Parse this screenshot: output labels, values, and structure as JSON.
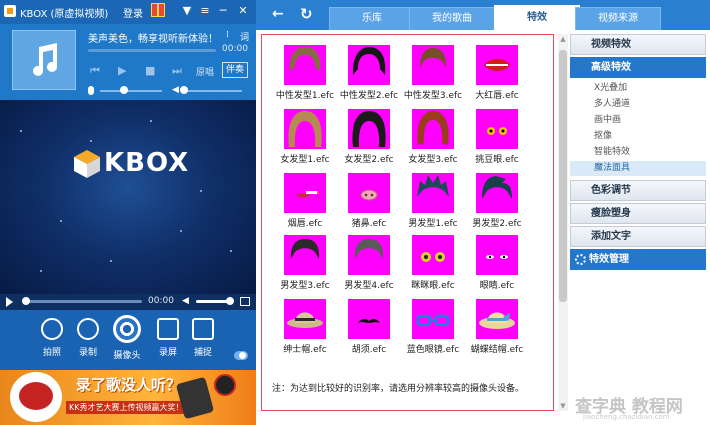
{
  "app": {
    "title": "KBOX (原虚拟视频)",
    "login_label": "登录"
  },
  "now_playing": {
    "song_title": "美声美色，畅享视听新体验！",
    "lyric_label": "词",
    "time": "00:00",
    "original_label": "原唱",
    "accompany_label": "伴奏",
    "progress": 0.0
  },
  "video": {
    "logo_text": "KBOX"
  },
  "playback": {
    "time": "00:00",
    "progress": 0.0,
    "volume": 0.8
  },
  "tools": [
    {
      "name": "photo",
      "label": "拍照",
      "icon": "camera-icon"
    },
    {
      "name": "record",
      "label": "录制",
      "icon": "video-record-icon"
    },
    {
      "name": "webcam",
      "label": "摄像头",
      "icon": "webcam-icon"
    },
    {
      "name": "screen-record",
      "label": "录屏",
      "icon": "screen-record-icon"
    },
    {
      "name": "capture",
      "label": "捕捉",
      "icon": "capture-icon"
    }
  ],
  "ad": {
    "headline": "录了歌没人听？",
    "subtext": "KK秀才艺大赛上传视频赢大奖！"
  },
  "tabs": [
    {
      "label": "乐库",
      "active": false
    },
    {
      "label": "我的歌曲",
      "active": false
    },
    {
      "label": "特效",
      "active": true
    },
    {
      "label": "视频来源",
      "active": false
    }
  ],
  "effects": [
    {
      "name": "中性发型1.efc",
      "kind": "hair-short-light"
    },
    {
      "name": "中性发型2.efc",
      "kind": "hair-black"
    },
    {
      "name": "中性发型3.efc",
      "kind": "hair-brown"
    },
    {
      "name": "大红唇.efc",
      "kind": "lips"
    },
    {
      "name": "女发型1.efc",
      "kind": "hair-long-light"
    },
    {
      "name": "女发型2.efc",
      "kind": "hair-long-black"
    },
    {
      "name": "女发型3.efc",
      "kind": "hair-red"
    },
    {
      "name": "挑豆眼.efc",
      "kind": "eyes-yellow"
    },
    {
      "name": "烟唇.efc",
      "kind": "cigarette"
    },
    {
      "name": "猪鼻.efc",
      "kind": "pig-nose"
    },
    {
      "name": "男发型1.efc",
      "kind": "hair-punk-teal"
    },
    {
      "name": "男发型2.efc",
      "kind": "hair-punk-teal2"
    },
    {
      "name": "男发型3.efc",
      "kind": "hair-man-dark"
    },
    {
      "name": "男发型4.efc",
      "kind": "hair-man-gray"
    },
    {
      "name": "眯眯眼.efc",
      "kind": "eyes-round"
    },
    {
      "name": "眼睛.efc",
      "kind": "eyes-small"
    },
    {
      "name": "绅士帽.efc",
      "kind": "hat-gentleman"
    },
    {
      "name": "胡须.efc",
      "kind": "mustache"
    },
    {
      "name": "蓝色眼镜.efc",
      "kind": "glasses-blue"
    },
    {
      "name": "蝴蝶结帽.efc",
      "kind": "hat-bow"
    }
  ],
  "note": "注：为达到比较好的识别率，请选用分辨率较高的摄像头设备。",
  "sidebar": {
    "sections": [
      {
        "label": "视频特效",
        "active": false
      },
      {
        "label": "高级特效",
        "active": true
      }
    ],
    "sub_items": [
      {
        "label": "X光叠加",
        "active": false
      },
      {
        "label": "多人通道",
        "active": false
      },
      {
        "label": "画中画",
        "active": false
      },
      {
        "label": "抠像",
        "active": false
      },
      {
        "label": "智能特效",
        "active": false
      },
      {
        "label": "魔法面具",
        "active": true
      }
    ],
    "more_sections": [
      {
        "label": "色彩调节"
      },
      {
        "label": "瘦脸塑身"
      },
      {
        "label": "添加文字"
      }
    ],
    "manage_label": "特效管理"
  },
  "watermark": {
    "text": "查字典 教程网",
    "sub": "jiaocheng.chazidian.com"
  },
  "colors": {
    "accent": "#2a7fd0",
    "effect_bg": "#ff00ff",
    "frame_border": "#e34d4d"
  }
}
